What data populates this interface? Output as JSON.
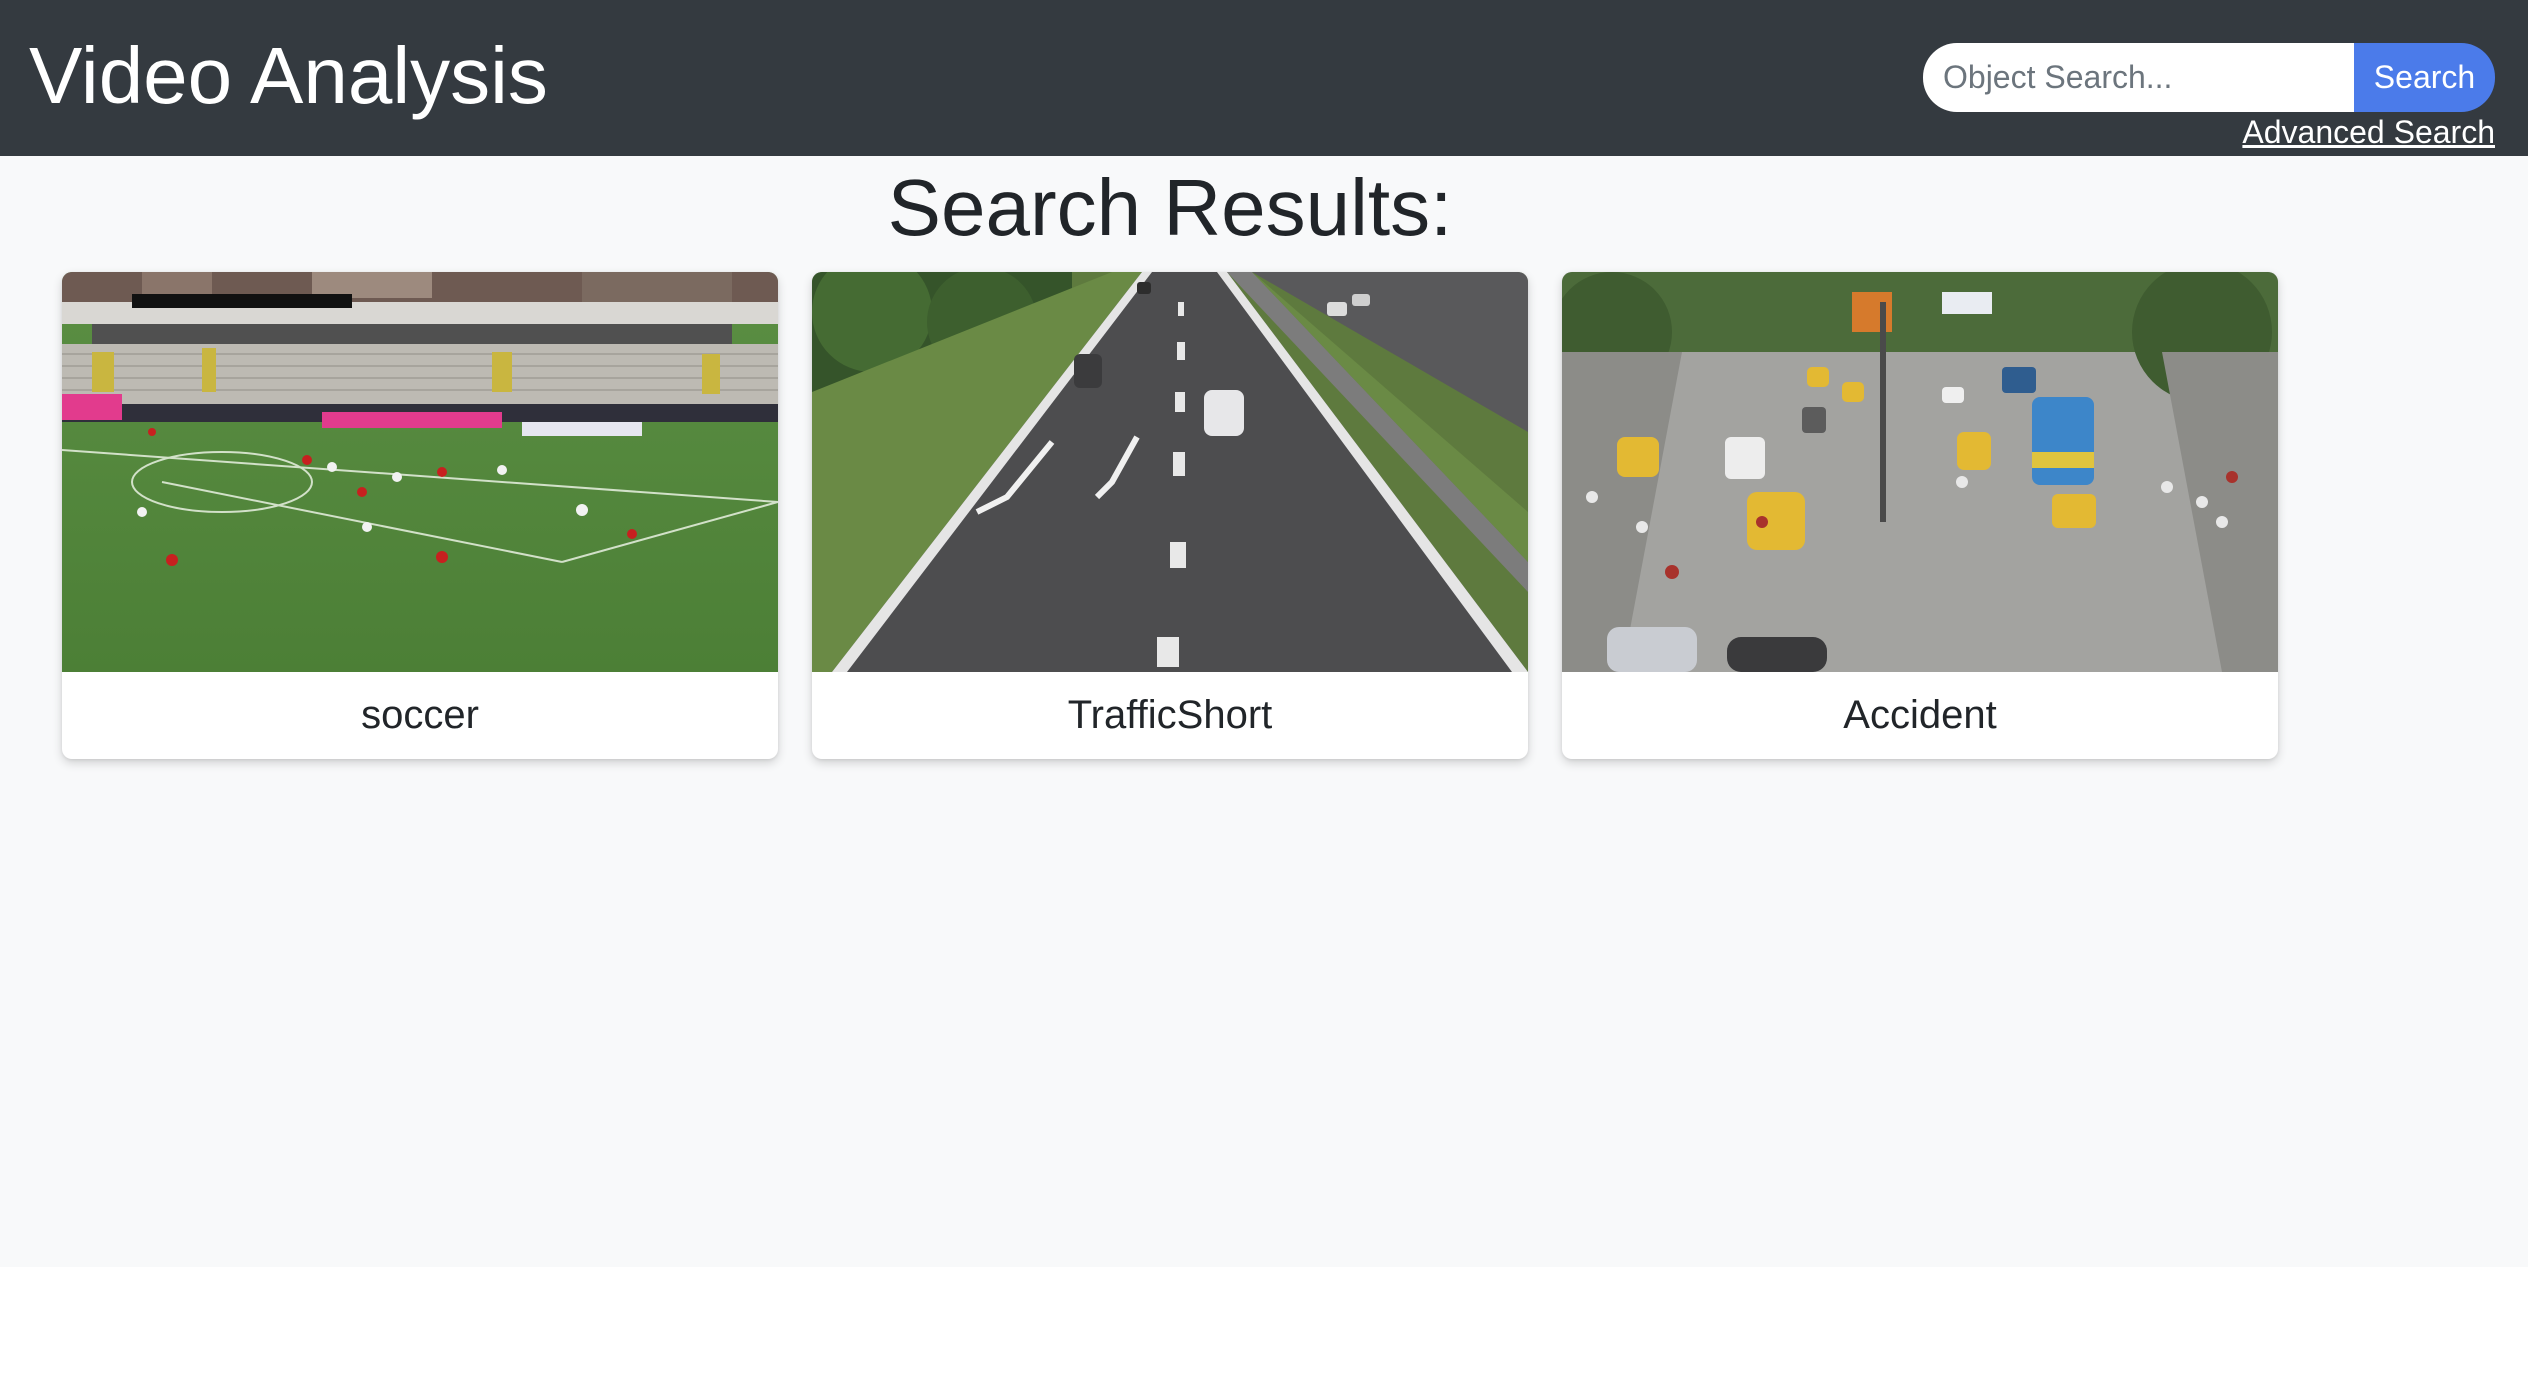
{
  "header": {
    "brand": "Video Analysis",
    "search": {
      "placeholder": "Object Search...",
      "button_label": "Search"
    },
    "advanced_search_label": "Advanced Search"
  },
  "main": {
    "heading": "Search Results:",
    "results": [
      {
        "title": "soccer",
        "thumbnail": "soccer-match-thumbnail"
      },
      {
        "title": "TrafficShort",
        "thumbnail": "highway-traffic-thumbnail"
      },
      {
        "title": "Accident",
        "thumbnail": "city-intersection-thumbnail"
      }
    ]
  },
  "colors": {
    "navbar": "#343a40",
    "page_background": "#f8f9fa",
    "search_button": "#4b7bea",
    "text": "#212529"
  }
}
